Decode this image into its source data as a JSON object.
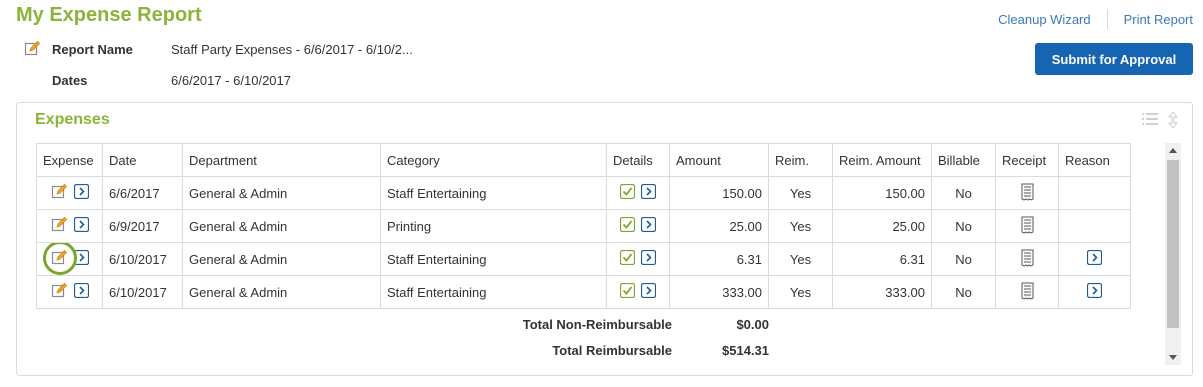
{
  "header": {
    "title": "My Expense Report",
    "links": {
      "cleanup": "Cleanup Wizard",
      "print": "Print Report"
    },
    "report_name_label": "Report Name",
    "report_name_value": "Staff Party Expenses - 6/6/2017 - 6/10/2...",
    "dates_label": "Dates",
    "dates_value": "6/6/2017 - 6/10/2017",
    "submit_label": "Submit for Approval"
  },
  "expenses": {
    "title": "Expenses",
    "columns": [
      "Expense",
      "Date",
      "Department",
      "Category",
      "Details",
      "Amount",
      "Reim.",
      "Reim. Amount",
      "Billable",
      "Receipt",
      "Reason"
    ],
    "rows": [
      {
        "date": "6/6/2017",
        "department": "General & Admin",
        "category": "Staff Entertaining",
        "amount": "150.00",
        "reim": "Yes",
        "reim_amount": "150.00",
        "billable": "No",
        "has_reason": false,
        "highlighted": false
      },
      {
        "date": "6/9/2017",
        "department": "General & Admin",
        "category": "Printing",
        "amount": "25.00",
        "reim": "Yes",
        "reim_amount": "25.00",
        "billable": "No",
        "has_reason": false,
        "highlighted": false
      },
      {
        "date": "6/10/2017",
        "department": "General & Admin",
        "category": "Staff Entertaining",
        "amount": "6.31",
        "reim": "Yes",
        "reim_amount": "6.31",
        "billable": "No",
        "has_reason": true,
        "highlighted": true
      },
      {
        "date": "6/10/2017",
        "department": "General & Admin",
        "category": "Staff Entertaining",
        "amount": "333.00",
        "reim": "Yes",
        "reim_amount": "333.00",
        "billable": "No",
        "has_reason": true,
        "highlighted": false
      }
    ],
    "totals": [
      {
        "label": "Total Non-Reimbursable",
        "value": "$0.00"
      },
      {
        "label": "Total Reimbursable",
        "value": "$514.31"
      }
    ]
  },
  "icons": {
    "edit": "edit-pencil-icon",
    "open": "chevron-right-box-icon",
    "details": "checkbox-checked-icon",
    "receipt": "receipt-icon",
    "list": "list-view-icon",
    "sort": "sort-arrows-icon"
  },
  "colors": {
    "accent_green": "#8cb33a",
    "link_blue": "#3a7ab8",
    "button_blue": "#1565b3",
    "icon_blue": "#1f5d8f"
  }
}
